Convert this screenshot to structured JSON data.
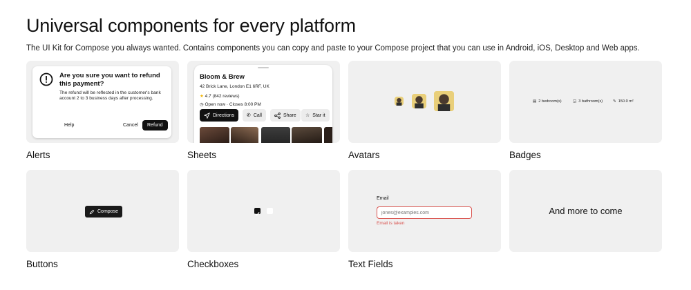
{
  "page": {
    "title": "Universal components for every platform",
    "subtitle": "The UI Kit for Compose you always wanted. Contains components you can copy and paste to your Compose project that you can use in Android, iOS, Desktop and Web apps."
  },
  "cards": {
    "alerts": {
      "label": "Alerts",
      "dialog_title": "Are you sure you want to refund this payment?",
      "dialog_body": "The refund will be reflected in the customer's bank account 2 to 3 business days after processing.",
      "help": "Help",
      "cancel": "Cancel",
      "refund": "Refund"
    },
    "sheets": {
      "label": "Sheets",
      "name": "Bloom & Brew",
      "address": "42 Brick Lane, London E1 6RF, UK",
      "rating": "4.7 (842 reviews)",
      "hours": "Open now · Closes 8:00 PM",
      "directions": "Directions",
      "call": "Call",
      "share": "Share",
      "star": "Star it"
    },
    "avatars": {
      "label": "Avatars"
    },
    "badges": {
      "label": "Badges",
      "bedrooms": "2 bedroom(s)",
      "bathrooms": "3 bathroom(s)",
      "area": "150.0 m²"
    },
    "buttons": {
      "label": "Buttons",
      "compose": "Compose"
    },
    "checkboxes": {
      "label": "Checkboxes",
      "checked": [
        true,
        false
      ]
    },
    "textfields": {
      "label": "Text Fields",
      "field_label": "Email",
      "placeholder": "jones@examples.com",
      "error": "Email is taken"
    },
    "more": {
      "text": "And more to come"
    }
  },
  "colors": {
    "card_bg": "#f0f0f0",
    "accent_dark": "#111111",
    "error": "#d9534f",
    "star": "#f2b400"
  }
}
